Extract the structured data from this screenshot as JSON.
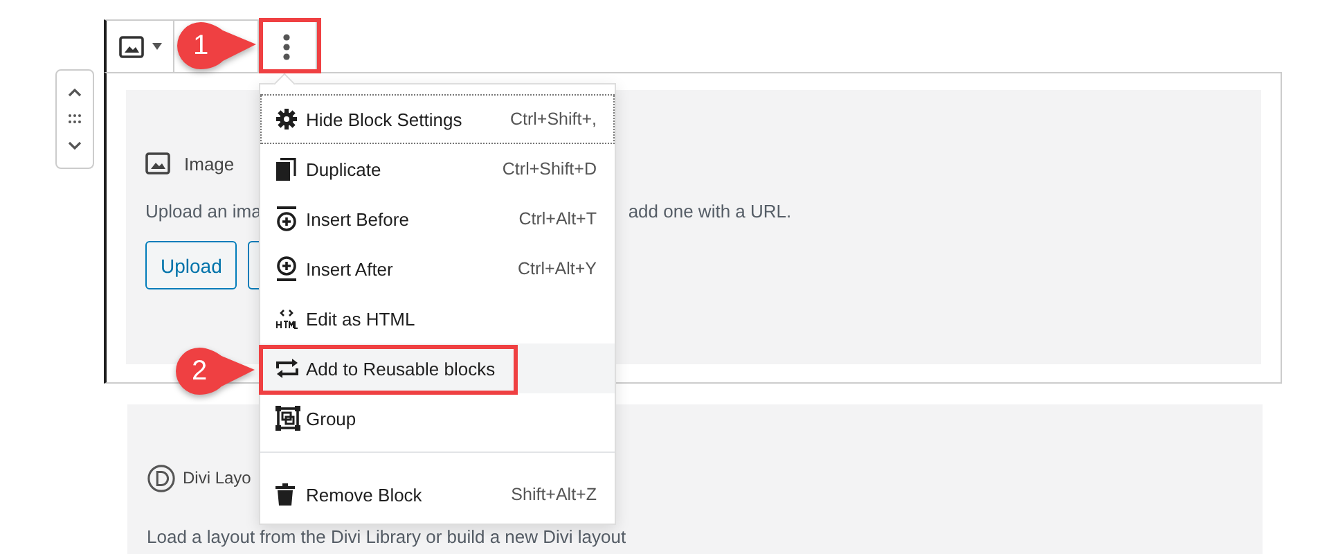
{
  "image_block": {
    "title": "Image",
    "instructions_left": "Upload an ima",
    "instructions_right": "add one with a URL.",
    "buttons": [
      "Upload"
    ]
  },
  "divi_block": {
    "title": "Divi Layo",
    "description": "Load a layout from the Divi Library or build a new Divi layout"
  },
  "menu": {
    "groups": [
      [
        {
          "label": "Hide Block Settings",
          "shortcut": "Ctrl+Shift+,",
          "focused": true,
          "hovered": false
        },
        {
          "label": "Duplicate",
          "shortcut": "Ctrl+Shift+D",
          "focused": false,
          "hovered": false
        },
        {
          "label": "Insert Before",
          "shortcut": "Ctrl+Alt+T",
          "focused": false,
          "hovered": false
        },
        {
          "label": "Insert After",
          "shortcut": "Ctrl+Alt+Y",
          "focused": false,
          "hovered": false
        },
        {
          "label": "Edit as HTML",
          "focused": false,
          "hovered": false
        },
        {
          "label": "Add to Reusable blocks",
          "focused": false,
          "hovered": true
        },
        {
          "label": "Group",
          "focused": false,
          "hovered": false
        }
      ],
      [
        {
          "label": "Remove Block",
          "shortcut": "Shift+Alt+Z",
          "focused": false,
          "hovered": false
        }
      ]
    ]
  },
  "annotations": [
    {
      "label": "1"
    },
    {
      "label": "2"
    }
  ]
}
